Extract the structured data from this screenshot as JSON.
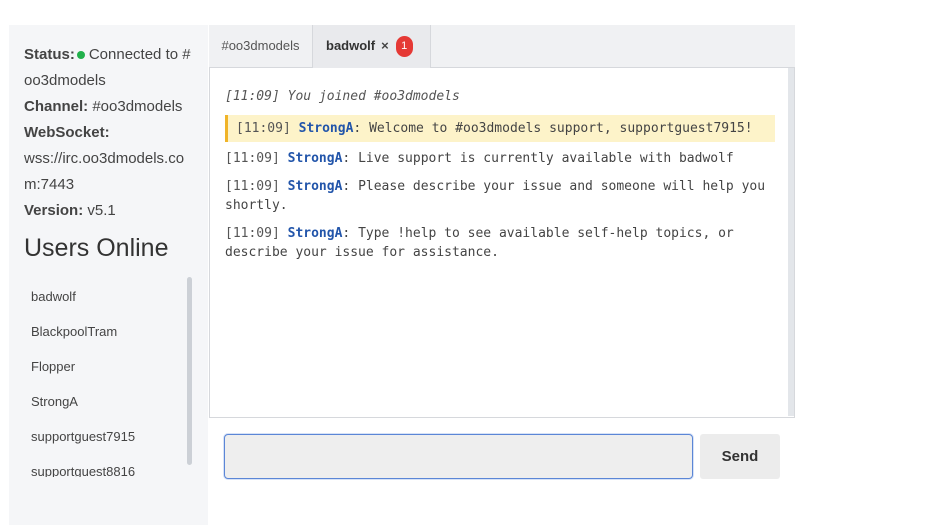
{
  "sidebar": {
    "status_label": "Status:",
    "status_value": "Connected to #oo3dmodels",
    "status_color": "#22b14c",
    "channel_label": "Channel:",
    "channel_value": "#oo3dmodels",
    "websocket_label": "WebSocket:",
    "websocket_value": "wss://irc.oo3dmodels.com:7443",
    "version_label": "Version:",
    "version_value": "v5.1",
    "users_title": "Users Online",
    "users": [
      "badwolf",
      "BlackpoolTram",
      "Flopper",
      "StrongA",
      "supportguest7915",
      "supportguest8816"
    ]
  },
  "tabs": [
    {
      "label": "#oo3dmodels"
    },
    {
      "label": "badwolf",
      "close": "×",
      "badge": "1"
    }
  ],
  "messages": [
    {
      "ts": "[11:09]",
      "text": "You joined #oo3dmodels",
      "type": "system"
    },
    {
      "ts": "[11:09]",
      "nick": "StrongA",
      "text": ": Welcome to #oo3dmodels support, supportguest7915!",
      "type": "highlight"
    },
    {
      "ts": "[11:09]",
      "nick": "StrongA",
      "text": ": Live support is currently available with badwolf",
      "type": "normal"
    },
    {
      "ts": "[11:09]",
      "nick": "StrongA",
      "text": ": Please describe your issue and someone will help you shortly.",
      "type": "normal"
    },
    {
      "ts": "[11:09]",
      "nick": "StrongA",
      "text": ": Type !help to see available self-help topics, or describe your issue for assistance.",
      "type": "normal"
    }
  ],
  "input": {
    "value": "",
    "placeholder": ""
  },
  "send_label": "Send",
  "colors": {
    "badge": "#e53935",
    "nick": "#2255aa",
    "highlight_bg": "#fdf3c9",
    "highlight_border": "#f0b429"
  }
}
